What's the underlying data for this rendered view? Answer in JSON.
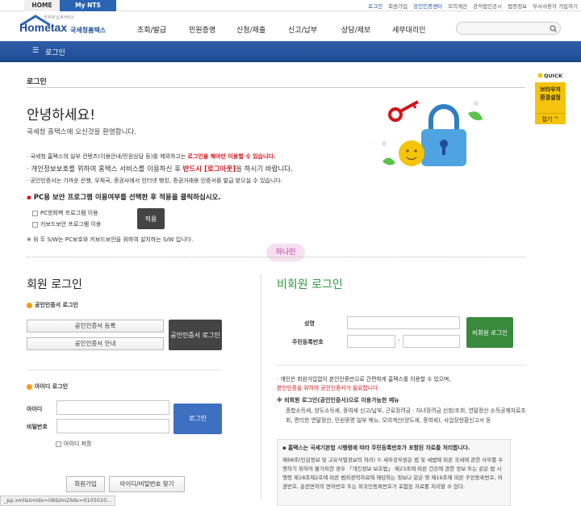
{
  "topbar": {
    "tab_home": "HOME",
    "tab_mynts": "My NTS",
    "links": [
      "로그인",
      "회원가입",
      "공인인증센터",
      "모의계산",
      "공익법인공시",
      "법령정보",
      "부서사용자 가입하기"
    ]
  },
  "header": {
    "logo_sub": "전자세 납세서비스",
    "logo_main": "Hometax",
    "logo_kr": "국세청홈택스",
    "nav": [
      "조회/발급",
      "민원증명",
      "신청/제출",
      "신고/납부",
      "상담/제보",
      "세무대리인"
    ]
  },
  "bluebar": {
    "title": "로그인"
  },
  "quick": {
    "label": "QUICK",
    "title": "브라우저 환경설정",
    "collapse": "접기"
  },
  "page": {
    "heading": "로그인",
    "greeting": "안녕하세요!",
    "welcome": "국세청 홈택스에 오신것을 환영합니다.",
    "notice1_a": "국세청 홈택스의 일부 컨텐츠(이용안내/민원상담 등)를 제외하고는 ",
    "notice1_b": "로그인을 해야만 이용할 수 있습니다.",
    "notice2_a": "개인정보보호를 위하여 홈택스 서비스를 이용하신 후 ",
    "notice2_b": "반드시 [로그아웃]",
    "notice2_c": "을 하시기 바랍니다.",
    "notice3": "공인인증서는 가까운 은행, 우체국, 증권사에서 인터넷 뱅킹, 증권거래용 인증서를 발급 받으실 수 있습니다.",
    "pc_title": "PC용 보안 프로그램 이용여부를 선택한 후 적용을 클릭하십시오.",
    "opt_firewall": "PC방화벽 프로그램 이용",
    "opt_keyboard": "키보드보안 프로그램 이용",
    "apply": "적용",
    "sw_note": "※ 위 두 S/W는 PC보호와 키보드보안을 위하여 설치하는 S/W 입니다.",
    "watermark": "하나인"
  },
  "member": {
    "title": "회원 로그인",
    "cert_section": "공인인증서 로그인",
    "cert_register": "공인인증서 등록",
    "cert_guide": "공인인증서 안내",
    "cert_login": "공인인증서 로그인",
    "id_section": "아이디 로그인",
    "id_label": "아이디",
    "pw_label": "비밀번호",
    "save_id": "아이디 저장",
    "login": "로그인",
    "join": "회원가입",
    "find": "아이디/비밀번호 찾기"
  },
  "guest": {
    "title": "비회원 로그인",
    "name_label": "성명",
    "rrn_label": "주민등록번호",
    "dash": "-",
    "login": "비회원 로그인",
    "info_a": "개인은 회원가입없이 본인인증만으로 간편하게 홈택스를 이용할 수 있으며,",
    "info_b": "본인인증을 위하여 공인인증서가 필요합니다.",
    "menu_title": "※ 비회원 로그인(공인인증서)으로 이용가능한 메뉴",
    "menu_text": "종합소득세, 양도소득세, 증여세 신고/납부, 근로장려금 · 자녀장려금 신청/조회, 연말정산 소득공제자료조회, 편리한 연말정산, 민원증명 일부 메뉴, 모의계산(양도세, 증여세), 사업장현황신고서 등",
    "notice_title": "홈택스는 국세기본법 시행령에 따라 주민등록번호가 포함된 자료를 처리합니다.",
    "notice_body": "제68조(민감정보 및 고유식별정보의 처리) ① 세무공무원은 법 및 세법에 따른 국세에 관한 사무를 수행하기 위하여 불가피한 경우 「개인정보 보호법」 제23조에 따른 건강에 관한 정보 또는 같은 법 시행령 제18조제2호에 따른 범죄경력자료에 해당하는 정보나 같은 영 제19조에 따른 주민등록번호, 여권번호, 운전면허의 면허번호 또는 외국인등록번호가 포함된 자료를 처리할 수 있다."
  },
  "statusbar": {
    "url": "_pp.xml&tmIdx=08&tm2lIdx=0105010..."
  }
}
